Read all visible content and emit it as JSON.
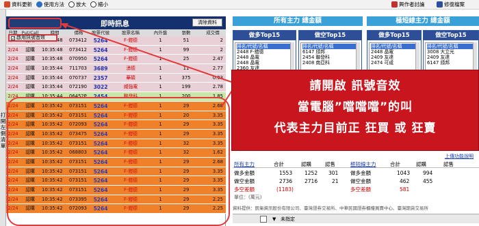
{
  "toolbar": {
    "items": [
      {
        "label": "資料更新",
        "icon": "refresh-icon"
      },
      {
        "label": "使用方法",
        "icon": "help-icon"
      },
      {
        "label": "放大",
        "icon": "zoom-in-icon"
      },
      {
        "label": "縮小",
        "icon": "zoom-out-icon"
      }
    ],
    "forum_label": "興作者討論",
    "mod_label": "修復檔案"
  },
  "sidebar": {
    "vertical_label": "打開左側清單"
  },
  "feed": {
    "title": "即時訊息",
    "clear_label": "清除資料",
    "sound_label": "啟用訊號音效",
    "columns": [
      "日期",
      "Put/Call",
      "時間",
      "價格",
      "股票代號",
      "股票名稱",
      "內外盤",
      "張數",
      "成交價"
    ],
    "rows": [
      {
        "date": "2/24",
        "type": "認購",
        "time": "10:35:48",
        "price": "073412",
        "code": "5264",
        "name": "F-鎧德",
        "io": "1",
        "qty": "51",
        "amt": "2",
        "bg": "#e8d0d6"
      },
      {
        "date": "2/24",
        "type": "認購",
        "time": "10:35:48",
        "price": "073412",
        "code": "5264",
        "name": "F-鎧德",
        "io": "1",
        "qty": "99",
        "amt": "2",
        "bg": "#e8d0d6"
      },
      {
        "date": "2/24",
        "type": "認購",
        "time": "10:35:48",
        "price": "070950",
        "code": "5264",
        "name": "F-鎧德",
        "io": "1",
        "qty": "25",
        "amt": "2.47",
        "bg": "#e8d0d6"
      },
      {
        "date": "2/24",
        "type": "認購",
        "time": "10:35:44",
        "price": "711703",
        "code": "3689",
        "name": "湧德",
        "io": "1",
        "qty": "11",
        "amt": "2.77",
        "bg": "#e8d0d6"
      },
      {
        "date": "2/24",
        "type": "認購",
        "time": "10:35:44",
        "price": "070737",
        "code": "2357",
        "name": "華碩",
        "io": "1",
        "qty": "375",
        "amt": "0.93",
        "bg": "#e8d0d6"
      },
      {
        "date": "2/24",
        "type": "認購",
        "time": "10:35:44",
        "price": "072190",
        "code": "3022",
        "name": "威強電",
        "io": "1",
        "qty": "199",
        "amt": "2.78",
        "bg": "#e8d0d6"
      },
      {
        "date": "2/24",
        "type": "認購",
        "time": "10:35:44",
        "price": "06452P",
        "code": "2454",
        "name": "聯發科",
        "io": "1",
        "qty": "200",
        "amt": "1.85",
        "bg": "#c9e6a8"
      },
      {
        "date": "2/24",
        "type": "認購",
        "time": "10:35:42",
        "price": "073151",
        "code": "5264",
        "name": "F-鎧德",
        "io": "1",
        "qty": "29",
        "amt": "2.68",
        "bg": "#f07a1e"
      },
      {
        "date": "2/24",
        "type": "認購",
        "time": "10:35:42",
        "price": "073151",
        "code": "5264",
        "name": "F-鎧德",
        "io": "1",
        "qty": "20",
        "amt": "3.35",
        "bg": "#f07a1e"
      },
      {
        "date": "2/24",
        "type": "認購",
        "time": "10:35:42",
        "price": "072093",
        "code": "5264",
        "name": "F-鎧德",
        "io": "1",
        "qty": "29",
        "amt": "3.35",
        "bg": "#f07a1e"
      },
      {
        "date": "2/24",
        "type": "認購",
        "time": "10:35:42",
        "price": "073475",
        "code": "5264",
        "name": "F-鎧德",
        "io": "1",
        "qty": "29",
        "amt": "3.35",
        "bg": "#f07a1e"
      },
      {
        "date": "2/24",
        "type": "認購",
        "time": "10:35:42",
        "price": "073151",
        "code": "5264",
        "name": "F-鎧德",
        "io": "1",
        "qty": "32",
        "amt": "3.35",
        "bg": "#f07a1e"
      },
      {
        "date": "2/24",
        "type": "認購",
        "time": "10:35:42",
        "price": "068803",
        "code": "5264",
        "name": "F-鎧德",
        "io": "1",
        "qty": "32",
        "amt": "1.62",
        "bg": "#f07a1e"
      },
      {
        "date": "2/24",
        "type": "認購",
        "time": "10:35:42",
        "price": "073151",
        "code": "5264",
        "name": "F-鎧德",
        "io": "1",
        "qty": "29",
        "amt": "2.68",
        "bg": "#f07a1e"
      },
      {
        "date": "2/24",
        "type": "認購",
        "time": "10:35:42",
        "price": "073151",
        "code": "5264",
        "name": "F-鎧德",
        "io": "1",
        "qty": "29",
        "amt": "3.35",
        "bg": "#f07a1e"
      },
      {
        "date": "2/24",
        "type": "認購",
        "time": "10:35:42",
        "price": "073151",
        "code": "5264",
        "name": "F-鎧德",
        "io": "1",
        "qty": "29",
        "amt": "3.35",
        "bg": "#f07a1e"
      },
      {
        "date": "2/24",
        "type": "認購",
        "time": "10:35:42",
        "price": "073151",
        "code": "5264",
        "name": "F-鎧德",
        "io": "1",
        "qty": "29",
        "amt": "3.35",
        "bg": "#f07a1e"
      },
      {
        "date": "2/24",
        "type": "認購",
        "time": "10:35:42",
        "price": "073395",
        "code": "5264",
        "name": "F-鎧德",
        "io": "1",
        "qty": "29",
        "amt": "2.25",
        "bg": "#f07a1e"
      },
      {
        "date": "2/24",
        "type": "認購",
        "time": "10:35:42",
        "price": "072093",
        "code": "5264",
        "name": "F-鎧德",
        "io": "1",
        "qty": "29",
        "amt": "2.25",
        "bg": "#f07a1e"
      }
    ]
  },
  "panel_left": {
    "title": "所有主力 總金額",
    "buy_title": "做多Top15",
    "sell_title": "做空Top15",
    "buy_list": [
      "排名/代號/名稱",
      "2448 F-鎧德",
      "2448 晶電",
      "2448 晶電",
      "2360 友達"
    ],
    "sell_list": [
      "排名/代號/名稱",
      "6147 頎邦",
      "2454 聯發科",
      "2408 南亞科"
    ]
  },
  "panel_right": {
    "title": "極短線主力 總金額",
    "buy_title": "做多Top15",
    "sell_title": "做空Top15",
    "buy_list": [
      "排名/代號/名稱",
      "2448 晶電",
      "2409 友達",
      "2474 可成"
    ],
    "sell_list": [
      "排名/代號/名稱",
      "3008 大立光",
      "2409 友達",
      "6147 頎邦"
    ]
  },
  "summary": {
    "help_link": "上傳功能說明",
    "left_header": [
      "所有主力",
      "合計",
      "認購",
      "認售"
    ],
    "left_rows": [
      {
        "label": "做多金額",
        "total": "1553",
        "call": "1252",
        "put": "301"
      },
      {
        "label": "做空金額",
        "total": "2736",
        "call": "2716",
        "put": "21"
      }
    ],
    "left_net": {
      "label": "多空差額",
      "total": "(1183)"
    },
    "right_header": [
      "極短線主力",
      "合計",
      "認購",
      "認售"
    ],
    "right_rows": [
      {
        "label": "做多金額",
        "total": "1043",
        "call": "994"
      },
      {
        "label": "做空金額",
        "total": "462",
        "call": "455"
      }
    ],
    "right_net": {
      "label": "多空差額",
      "total": "581"
    },
    "unit": "單位：(萬元)"
  },
  "bottom": {
    "source_text": "資料提供：凱衛資訊股份有限公司、臺灣證券交易所、中華民國證券櫃檯買賣中心、臺灣期貨交易所",
    "filter_label": "未指定"
  },
  "callout": {
    "lines": [
      "請開啟 訊號音效",
      "當電腦”噹噹噹”的叫",
      "代表主力目前正 狂買 或 狂賣"
    ]
  },
  "colors": {
    "header_navy": "#14306e",
    "orange_row": "#f07a1e",
    "pink_row": "#e8d0d6",
    "callout_red": "#c8151e",
    "accent_blue": "#3aa0d8"
  }
}
